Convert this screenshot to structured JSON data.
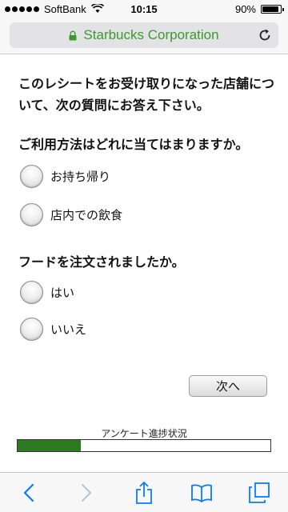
{
  "status_bar": {
    "carrier": "SoftBank",
    "time": "10:15",
    "battery": "90%",
    "battery_level": 0.9
  },
  "browser": {
    "url_label": "Starbucks Corporation",
    "url_color": "#3a9a2e"
  },
  "survey": {
    "intro": "このレシートをお受け取りになった店舗について、次の質問にお答え下さい。",
    "questions": [
      {
        "text": "ご利用方法はどれに当てはまりますか。",
        "options": [
          "お持ち帰り",
          "店内での飲食"
        ]
      },
      {
        "text": "フードを注文されましたか。",
        "options": [
          "はい",
          "いいえ"
        ]
      }
    ],
    "next_label": "次へ",
    "progress_label": "アンケート進捗状況",
    "progress_fraction": 0.25,
    "progress_color": "#2d7a23"
  },
  "toolbar": {
    "icons": [
      "back-icon",
      "forward-icon",
      "share-icon",
      "bookmarks-icon",
      "tabs-icon"
    ]
  }
}
